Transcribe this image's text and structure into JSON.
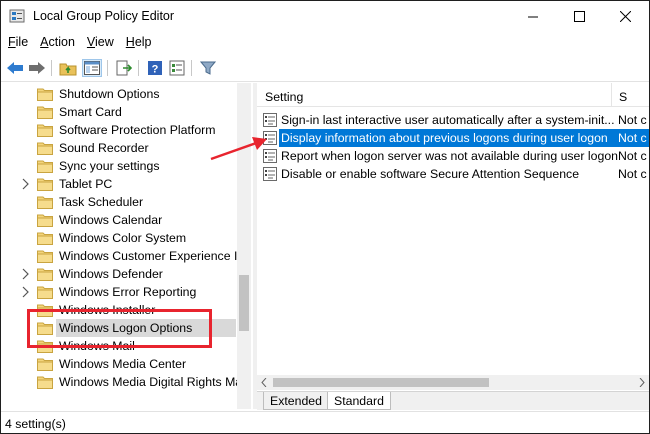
{
  "window": {
    "title": "Local Group Policy Editor",
    "accent": "#0078d7"
  },
  "menu": {
    "file": "ile",
    "file_ul": "F",
    "action": "ction",
    "action_ul": "A",
    "view": "iew",
    "view_ul": "V",
    "help": "elp",
    "help_ul": "H"
  },
  "toolbar": {
    "icons": [
      "back-arrow-icon",
      "forward-arrow-icon",
      "up-folder-icon",
      "show-hide-tree-icon",
      "export-list-icon",
      "help-icon",
      "properties-icon",
      "filter-icon"
    ]
  },
  "tree": {
    "items": [
      {
        "label": "Shutdown Options",
        "expandable": false
      },
      {
        "label": "Smart Card",
        "expandable": false
      },
      {
        "label": "Software Protection Platform",
        "expandable": false
      },
      {
        "label": "Sound Recorder",
        "expandable": false
      },
      {
        "label": "Sync your settings",
        "expandable": false
      },
      {
        "label": "Tablet PC",
        "expandable": true
      },
      {
        "label": "Task Scheduler",
        "expandable": false
      },
      {
        "label": "Windows Calendar",
        "expandable": false
      },
      {
        "label": "Windows Color System",
        "expandable": false
      },
      {
        "label": "Windows Customer Experience In",
        "expandable": false
      },
      {
        "label": "Windows Defender",
        "expandable": true
      },
      {
        "label": "Windows Error Reporting",
        "expandable": true
      },
      {
        "label": "Windows Installer",
        "expandable": false
      },
      {
        "label": "Windows Logon Options",
        "expandable": false,
        "selected": true
      },
      {
        "label": "Windows Mail",
        "expandable": false
      },
      {
        "label": "Windows Media Center",
        "expandable": false
      },
      {
        "label": "Windows Media Digital Rights Ma",
        "expandable": false
      }
    ]
  },
  "list": {
    "col_setting": "Setting",
    "col_state": "S",
    "rows": [
      {
        "text": "Sign-in last interactive user automatically after a system-init...",
        "state": "Not c"
      },
      {
        "text": "Display information about previous logons during user logon",
        "state": "Not c",
        "selected": true
      },
      {
        "text": "Report when logon server was not available during user logon",
        "state": "Not c"
      },
      {
        "text": "Disable or enable software Secure Attention Sequence",
        "state": "Not c"
      }
    ]
  },
  "tabs": {
    "extended": "Extended",
    "standard": "Standard"
  },
  "status": {
    "text": "4 setting(s)"
  },
  "annotation": {
    "color": "#e8242e"
  }
}
